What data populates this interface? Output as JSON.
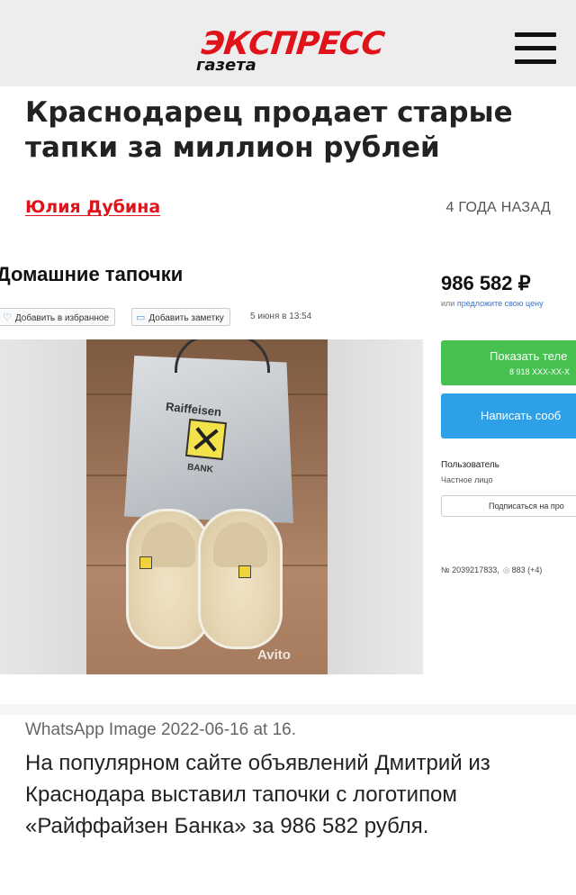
{
  "header": {
    "logo_main": "ЭКСПРЕСС",
    "logo_sub": "газета",
    "menu_icon": "hamburger-menu-icon",
    "background": "#ededed",
    "brand_color": "#e0131a"
  },
  "article": {
    "title": "Краснодарец продает старые тапки за миллион рублей",
    "author": "Юлия Дубина",
    "published": "4 ГОДА НАЗАД"
  },
  "screenshot": {
    "ad_title": "Домашние тапочки",
    "favorite_button": "Добавить в избранное",
    "note_button": "Добавить заметку",
    "ad_date": "5 июня в 13:54",
    "bag_brand": "Raiffeisen",
    "bag_bank": "BANK",
    "watermark": "Avito",
    "price": "986 582 ₽",
    "price_sub_prefix": "или",
    "price_sub_link": "предложите свою цену",
    "show_phone_button": "Показать теле",
    "phone": "8 918 XXX-XX-X",
    "write_message_button": "Написать сооб",
    "seller_label": "Пользователь",
    "seller_type": "Частное лицо",
    "subscribe_button": "Подписаться на про",
    "ad_number": "№ 2039217833,",
    "views": "883 (+4)",
    "green": "#46c150",
    "blue": "#2da0e8"
  },
  "caption": "WhatsApp Image 2022-06-16 at 16.",
  "lede": "На популярном сайте объявлений Дмитрий из Краснодара выставил тапочки с логотипом «Райффайзен Банка» за 986 582 рубля."
}
